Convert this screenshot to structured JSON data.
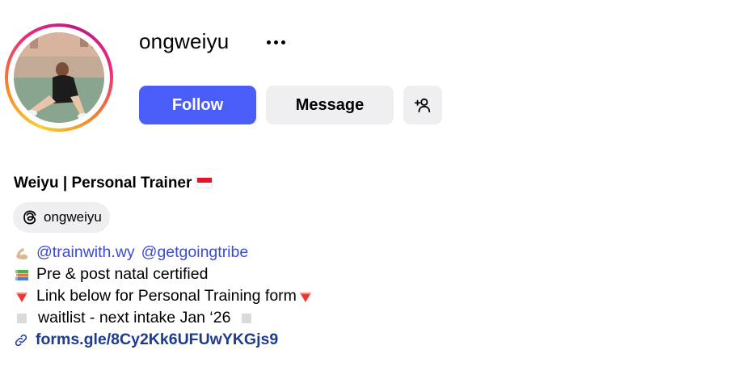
{
  "profile": {
    "username": "ongweiyu",
    "full_name": "Weiyu | Personal Trainer",
    "flag": "Singapore flag",
    "threads_handle": "ongweiyu"
  },
  "actions": {
    "follow_label": "Follow",
    "message_label": "Message",
    "more_icon": "more-icon",
    "suggest_icon": "add-person-icon"
  },
  "bio": {
    "mention_1": "@trainwith.wy",
    "mention_2": "@getgoingtribe",
    "line_2": "Pre & post natal certified",
    "line_3_text": "Link below for Personal Training form",
    "line_4_text": "waitlist - next intake Jan ‘26",
    "link_text": "forms.gle/8Cy2Kk6UFUwYKGjs9"
  },
  "colors": {
    "follow_button": "#4a5df9",
    "mention": "#3b4bd1",
    "link": "#1d3b8f",
    "secondary_button": "#efeff2"
  }
}
